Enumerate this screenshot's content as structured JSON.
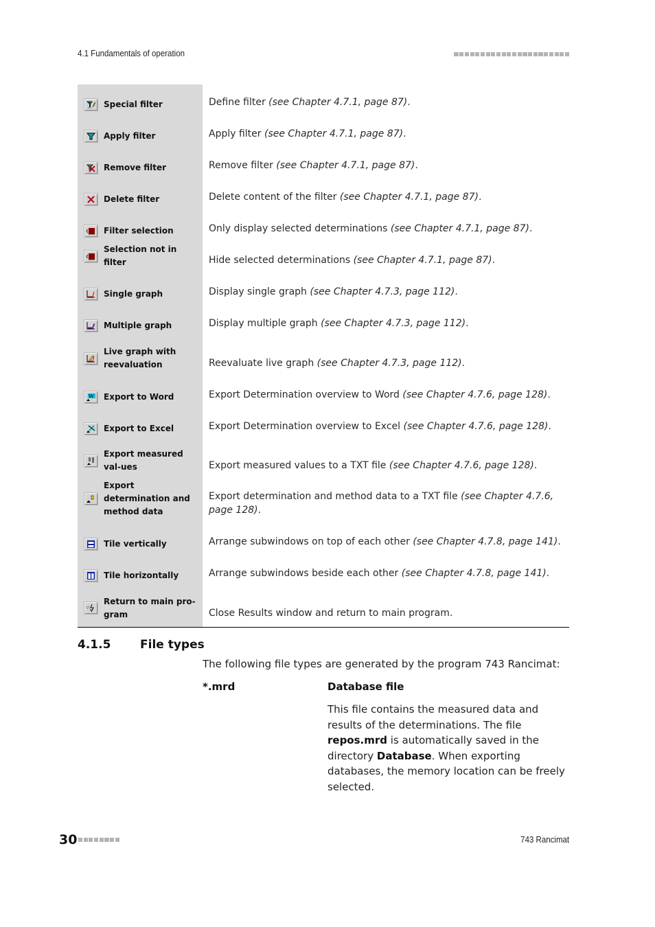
{
  "header": {
    "section_ref": "4.1 Fundamentals of operation",
    "decoration_squares": 22
  },
  "toolbar_table": {
    "rows": [
      {
        "icon": "special-filter-icon",
        "name": "Special filter",
        "desc": "Define filter ",
        "ref": "(see Chapter 4.7.1, page 87)",
        "end": "."
      },
      {
        "icon": "apply-filter-icon",
        "name": "Apply filter",
        "desc": "Apply filter ",
        "ref": "(see Chapter 4.7.1, page 87)",
        "end": "."
      },
      {
        "icon": "remove-filter-icon",
        "name": "Remove filter",
        "desc": "Remove filter ",
        "ref": "(see Chapter 4.7.1, page 87)",
        "end": "."
      },
      {
        "icon": "delete-filter-icon",
        "name": "Delete filter",
        "desc": "Delete content of the filter ",
        "ref": "(see Chapter 4.7.1, page 87)",
        "end": "."
      },
      {
        "icon": "filter-selection-icon",
        "name": "Filter selection",
        "desc": "Only display selected determinations ",
        "ref": "(see Chapter 4.7.1, page 87)",
        "end": "."
      },
      {
        "icon": "selection-not-in-filter-icon",
        "name": "Selection not in filter",
        "desc": "Hide selected determinations ",
        "ref": "(see Chapter 4.7.1, page 87)",
        "end": "."
      },
      {
        "icon": "single-graph-icon",
        "name": "Single graph",
        "desc": "Display single graph ",
        "ref": "(see Chapter 4.7.3, page 112)",
        "end": "."
      },
      {
        "icon": "multiple-graph-icon",
        "name": "Multiple graph",
        "desc": "Display multiple graph ",
        "ref": "(see Chapter 4.7.3, page 112)",
        "end": "."
      },
      {
        "icon": "live-graph-reevaluation-icon",
        "name": "Live graph with reevaluation",
        "desc": "Reevaluate live graph ",
        "ref": "(see Chapter 4.7.3, page 112)",
        "end": "."
      },
      {
        "icon": "export-to-word-icon",
        "name": "Export to Word",
        "desc": "Export Determination overview to Word ",
        "ref": "(see Chapter 4.7.6, page 128)",
        "end": "."
      },
      {
        "icon": "export-to-excel-icon",
        "name": "Export to Excel",
        "desc": "Export Determination overview to Excel ",
        "ref": "(see Chapter 4.7.6, page 128)",
        "end": "."
      },
      {
        "icon": "export-measured-values-icon",
        "name": "Export measured val-ues",
        "desc": "Export measured values to a TXT file ",
        "ref": "(see Chapter 4.7.6, page 128)",
        "end": "."
      },
      {
        "icon": "export-determination-method-data-icon",
        "name": "Export determination and method data",
        "desc": "Export determination and method data to a TXT file ",
        "ref": "(see Chapter 4.7.6, page 128)",
        "end": "."
      },
      {
        "icon": "tile-vertically-icon",
        "name": "Tile vertically",
        "desc": "Arrange subwindows on top of each other ",
        "ref": "(see Chapter 4.7.8, page 141)",
        "end": "."
      },
      {
        "icon": "tile-horizontally-icon",
        "name": "Tile horizontally",
        "desc": "Arrange subwindows beside each other ",
        "ref": "(see Chapter 4.7.8, page 141)",
        "end": "."
      },
      {
        "icon": "return-to-main-program-icon",
        "name": "Return to main pro-gram",
        "desc": "Close Results window and return to main program.",
        "ref": "",
        "end": ""
      }
    ]
  },
  "file_types_section": {
    "number": "4.1.5",
    "title": "File types",
    "intro": "The following file types are generated by the program 743 Rancimat:",
    "entries": [
      {
        "extension": "*.mrd",
        "title": "Database file",
        "body_parts": [
          {
            "text": "This file contains the measured data and results of the determinations. The file ",
            "bold": false
          },
          {
            "text": "repos.mrd",
            "bold": true
          },
          {
            "text": " is automatically saved in the directory ",
            "bold": false
          },
          {
            "text": "Database",
            "bold": true
          },
          {
            "text": ". When exporting databases, the memory location can be freely selected.",
            "bold": false
          }
        ]
      }
    ]
  },
  "footer": {
    "page_number": "30",
    "product": "743 Rancimat",
    "decoration_squares": 8
  }
}
